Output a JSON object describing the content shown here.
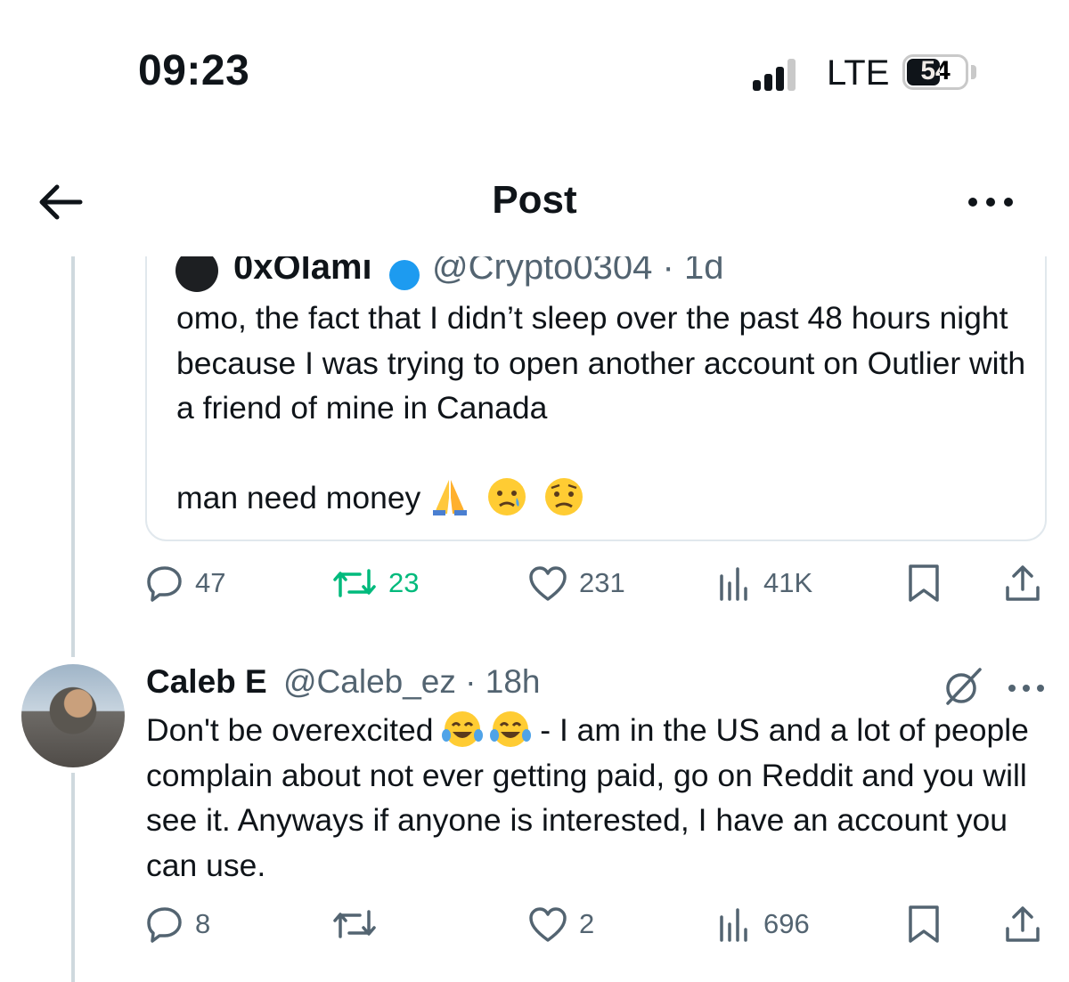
{
  "status_bar": {
    "time": "09:23",
    "network": "LTE",
    "battery": "54"
  },
  "header": {
    "title": "Post"
  },
  "quoted_post": {
    "author_name": "0xOlami",
    "handle": "@Crypto0304 · 1d",
    "text": "omo, the fact that I didn’t sleep over the past 48 hours night because I was trying to open another account on Outlier with a friend of mine in Canada\n\nman need money",
    "emojis": [
      "folded-hands",
      "crying-face",
      "worried-face"
    ]
  },
  "post_actions": {
    "replies": "47",
    "reposts": "23",
    "likes": "231",
    "views": "41K"
  },
  "reply": {
    "author_name": "Caleb E",
    "handle_time": "@Caleb_ez · 18h",
    "text_before_emoji": "Don't be overexcited ",
    "emojis": [
      "face-with-tears-of-joy",
      "face-with-tears-of-joy"
    ],
    "text_after_emoji": " - I am in the US and a lot of people complain about not ever getting paid, go on Reddit and you will see it. Anyways if anyone is interested, I have an account you can use.",
    "actions": {
      "replies": "8",
      "reposts": "",
      "likes": "2",
      "views": "696"
    }
  },
  "colors": {
    "text": "#0f1419",
    "muted": "#536471",
    "repost_green": "#00ba7c",
    "border": "#e1e8ed"
  }
}
